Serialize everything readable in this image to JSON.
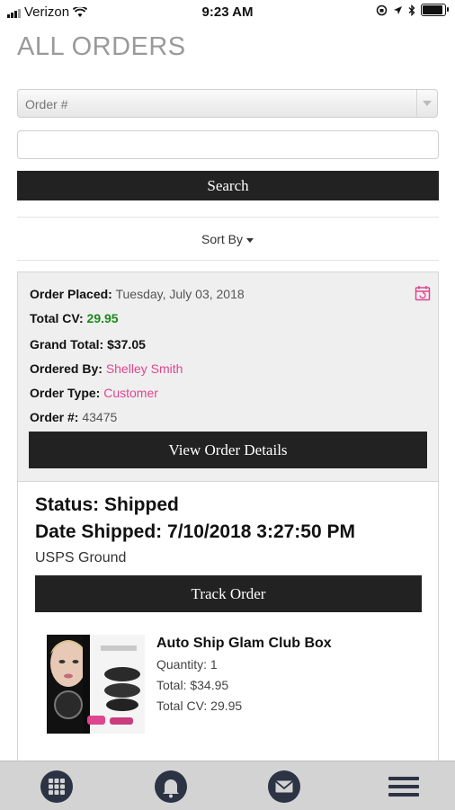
{
  "status_bar": {
    "carrier": "Verizon",
    "time": "9:23 AM"
  },
  "page": {
    "title": "ALL ORDERS"
  },
  "filter": {
    "select_value": "Order #",
    "search_value": "",
    "search_label": "Search",
    "sort_label": "Sort By"
  },
  "order": {
    "placed_label": "Order Placed:",
    "placed_value": "Tuesday, July 03, 2018",
    "cv_label": "Total CV:",
    "cv_value": "29.95",
    "grand_label": "Grand Total:",
    "grand_value": "$37.05",
    "ordered_by_label": "Ordered By:",
    "ordered_by_value": "Shelley Smith",
    "type_label": "Order Type:",
    "type_value": "Customer",
    "number_label": "Order #:",
    "number_value": "43475",
    "view_label": "View Order Details"
  },
  "shipment": {
    "status": "Status: Shipped",
    "date": "Date Shipped: 7/10/2018 3:27:50 PM",
    "method": "USPS Ground",
    "track_label": "Track Order"
  },
  "item": {
    "name": "Auto Ship Glam Club Box",
    "quantity": "Quantity: 1",
    "total": "Total: $34.95",
    "cv": "Total CV: 29.95"
  },
  "icons": {
    "grid": "grid-icon",
    "bell": "bell-icon",
    "mail": "mail-icon",
    "menu": "menu-icon",
    "calendar": "calendar-icon"
  },
  "colors": {
    "accent_pink": "#e0458f",
    "cv_green": "#1a8a1a",
    "button_dark": "#222222",
    "tab_icon": "#2b3345"
  }
}
